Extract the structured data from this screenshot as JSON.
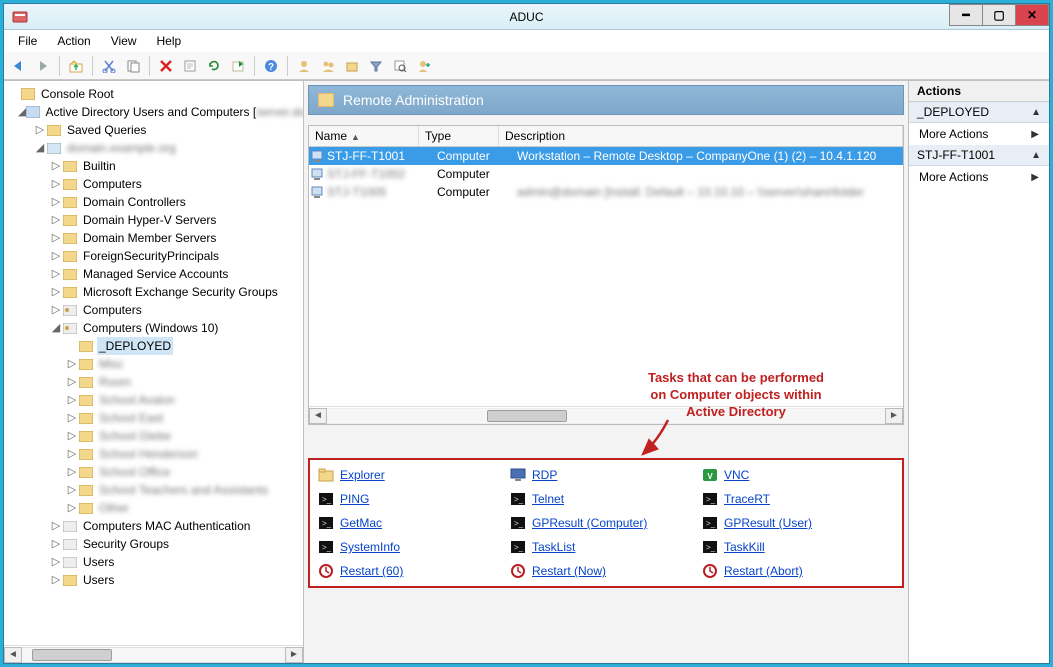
{
  "window": {
    "title": "ADUC"
  },
  "menu": {
    "file": "File",
    "action": "Action",
    "view": "View",
    "help": "Help"
  },
  "tree": {
    "root": "Console Root",
    "ad": "Active Directory Users and Computers [",
    "saved_queries": "Saved Queries",
    "domain_blur": "domain.example.org",
    "builtin": "Builtin",
    "computers": "Computers",
    "domain_controllers": "Domain Controllers",
    "hyperv": "Domain Hyper-V Servers",
    "member": "Domain Member Servers",
    "fsp": "ForeignSecurityPrincipals",
    "msa": "Managed Service Accounts",
    "mesg": "Microsoft Exchange Security Groups",
    "ou_computers": "Computers",
    "ou_computers_w10": "Computers (Windows 10)",
    "deployed": "_DEPLOYED",
    "sub_blur": [
      "Misc",
      "Room",
      "School Avalon",
      "School East",
      "School Glebe",
      "School Henderson",
      "School Office",
      "School Teachers and Assistants",
      "Other"
    ],
    "mac_auth": "Computers MAC Authentication",
    "sec_groups": "Security Groups",
    "users1": "Users",
    "users2": "Users"
  },
  "panel": {
    "title": "Remote Administration"
  },
  "columns": {
    "name": "Name",
    "type": "Type",
    "desc": "Description"
  },
  "rows": [
    {
      "name": "STJ-FF-T1001",
      "type": "Computer",
      "desc": "Workstation – Remote Desktop – CompanyOne (1) (2) – 10.4.1.120",
      "selected": true
    },
    {
      "name": "STJ-FF-T1002",
      "type": "Computer",
      "desc": ""
    },
    {
      "name": "STJ-T1005",
      "type": "Computer",
      "desc": "admin@domain  [Install: Default – 10.10.10 – \\\\server\\share\\folder"
    }
  ],
  "annotation": {
    "l1": "Tasks that can be performed",
    "l2": "on Computer objects within",
    "l3": "Active Directory"
  },
  "tasks": [
    {
      "label": "Explorer",
      "icon": "folder"
    },
    {
      "label": "RDP",
      "icon": "monitor"
    },
    {
      "label": "VNC",
      "icon": "vnc"
    },
    {
      "label": "PING",
      "icon": "cmd"
    },
    {
      "label": "Telnet",
      "icon": "cmd"
    },
    {
      "label": "TraceRT",
      "icon": "cmd"
    },
    {
      "label": "GetMac",
      "icon": "cmd"
    },
    {
      "label": "GPResult (Computer)",
      "icon": "cmd"
    },
    {
      "label": "GPResult (User)",
      "icon": "cmd"
    },
    {
      "label": "SystemInfo",
      "icon": "cmd"
    },
    {
      "label": "TaskList",
      "icon": "cmd"
    },
    {
      "label": "TaskKill",
      "icon": "cmd"
    },
    {
      "label": "Restart (60)",
      "icon": "clock"
    },
    {
      "label": "Restart (Now)",
      "icon": "clock"
    },
    {
      "label": "Restart (Abort)",
      "icon": "clock"
    }
  ],
  "actions": {
    "title": "Actions",
    "section1": "_DEPLOYED",
    "more1": "More Actions",
    "section2": "STJ-FF-T1001",
    "more2": "More Actions"
  }
}
